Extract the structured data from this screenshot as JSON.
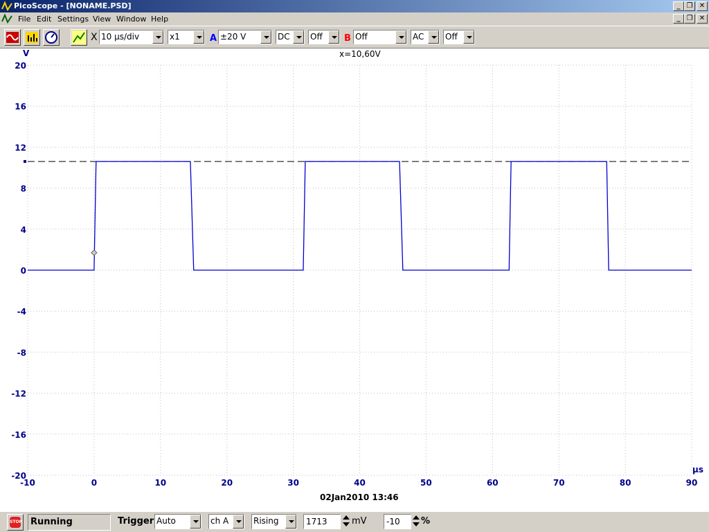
{
  "window": {
    "title": "PicoScope - [NONAME.PSD]"
  },
  "menu": {
    "items": [
      "File",
      "Edit",
      "Settings",
      "View",
      "Window",
      "Help"
    ]
  },
  "toolbar": {
    "timebase_prefix": "X",
    "timebase": "10 µs/div",
    "multiplier": "x1",
    "chA_label": "A",
    "chA_range": "±20 V",
    "chA_coupling": "DC",
    "chA_option": "Off",
    "chB_label": "B",
    "chB_range": "Off",
    "chB_coupling": "AC",
    "chB_option": "Off"
  },
  "plot": {
    "cursor_readout": "x=10,60V",
    "y_unit": "V",
    "x_unit": "µs",
    "datetime": "02Jan2010  13:46"
  },
  "status": {
    "run_state": "Running",
    "trigger_label": "Trigger",
    "trigger_mode": "Auto",
    "trigger_channel": "ch A",
    "trigger_edge": "Rising",
    "trigger_level": "1713",
    "trigger_level_unit": "mV",
    "pretrigger": "-10",
    "pretrigger_unit": "%"
  },
  "colors": {
    "trace": "#0000cc",
    "axis_text": "#00008b",
    "grid": "#c0c0c0",
    "chA": "#0000ff",
    "chB": "#ff0000"
  },
  "chart_data": {
    "type": "line",
    "title": "",
    "xlabel": "µs",
    "ylabel": "V",
    "xlim": [
      -10,
      90
    ],
    "ylim": [
      -20,
      20
    ],
    "x_ticks": [
      -10,
      0,
      10,
      20,
      30,
      40,
      50,
      60,
      70,
      80,
      90
    ],
    "y_ticks": [
      20,
      16,
      12,
      8,
      4,
      0,
      -4,
      -8,
      -12,
      -16,
      -20
    ],
    "grid": true,
    "reference_level": 10.6,
    "trigger_marker": {
      "x": 0,
      "y": 1.7
    },
    "series": [
      {
        "name": "",
        "x": [
          -10,
          0,
          0.3,
          14.5,
          15.0,
          31.5,
          31.8,
          46.0,
          46.5,
          62.5,
          62.8,
          77.2,
          77.5,
          90
        ],
        "y": [
          0,
          0,
          10.6,
          10.6,
          0,
          0,
          10.6,
          10.6,
          0,
          0,
          10.6,
          10.6,
          0,
          0
        ]
      }
    ]
  }
}
